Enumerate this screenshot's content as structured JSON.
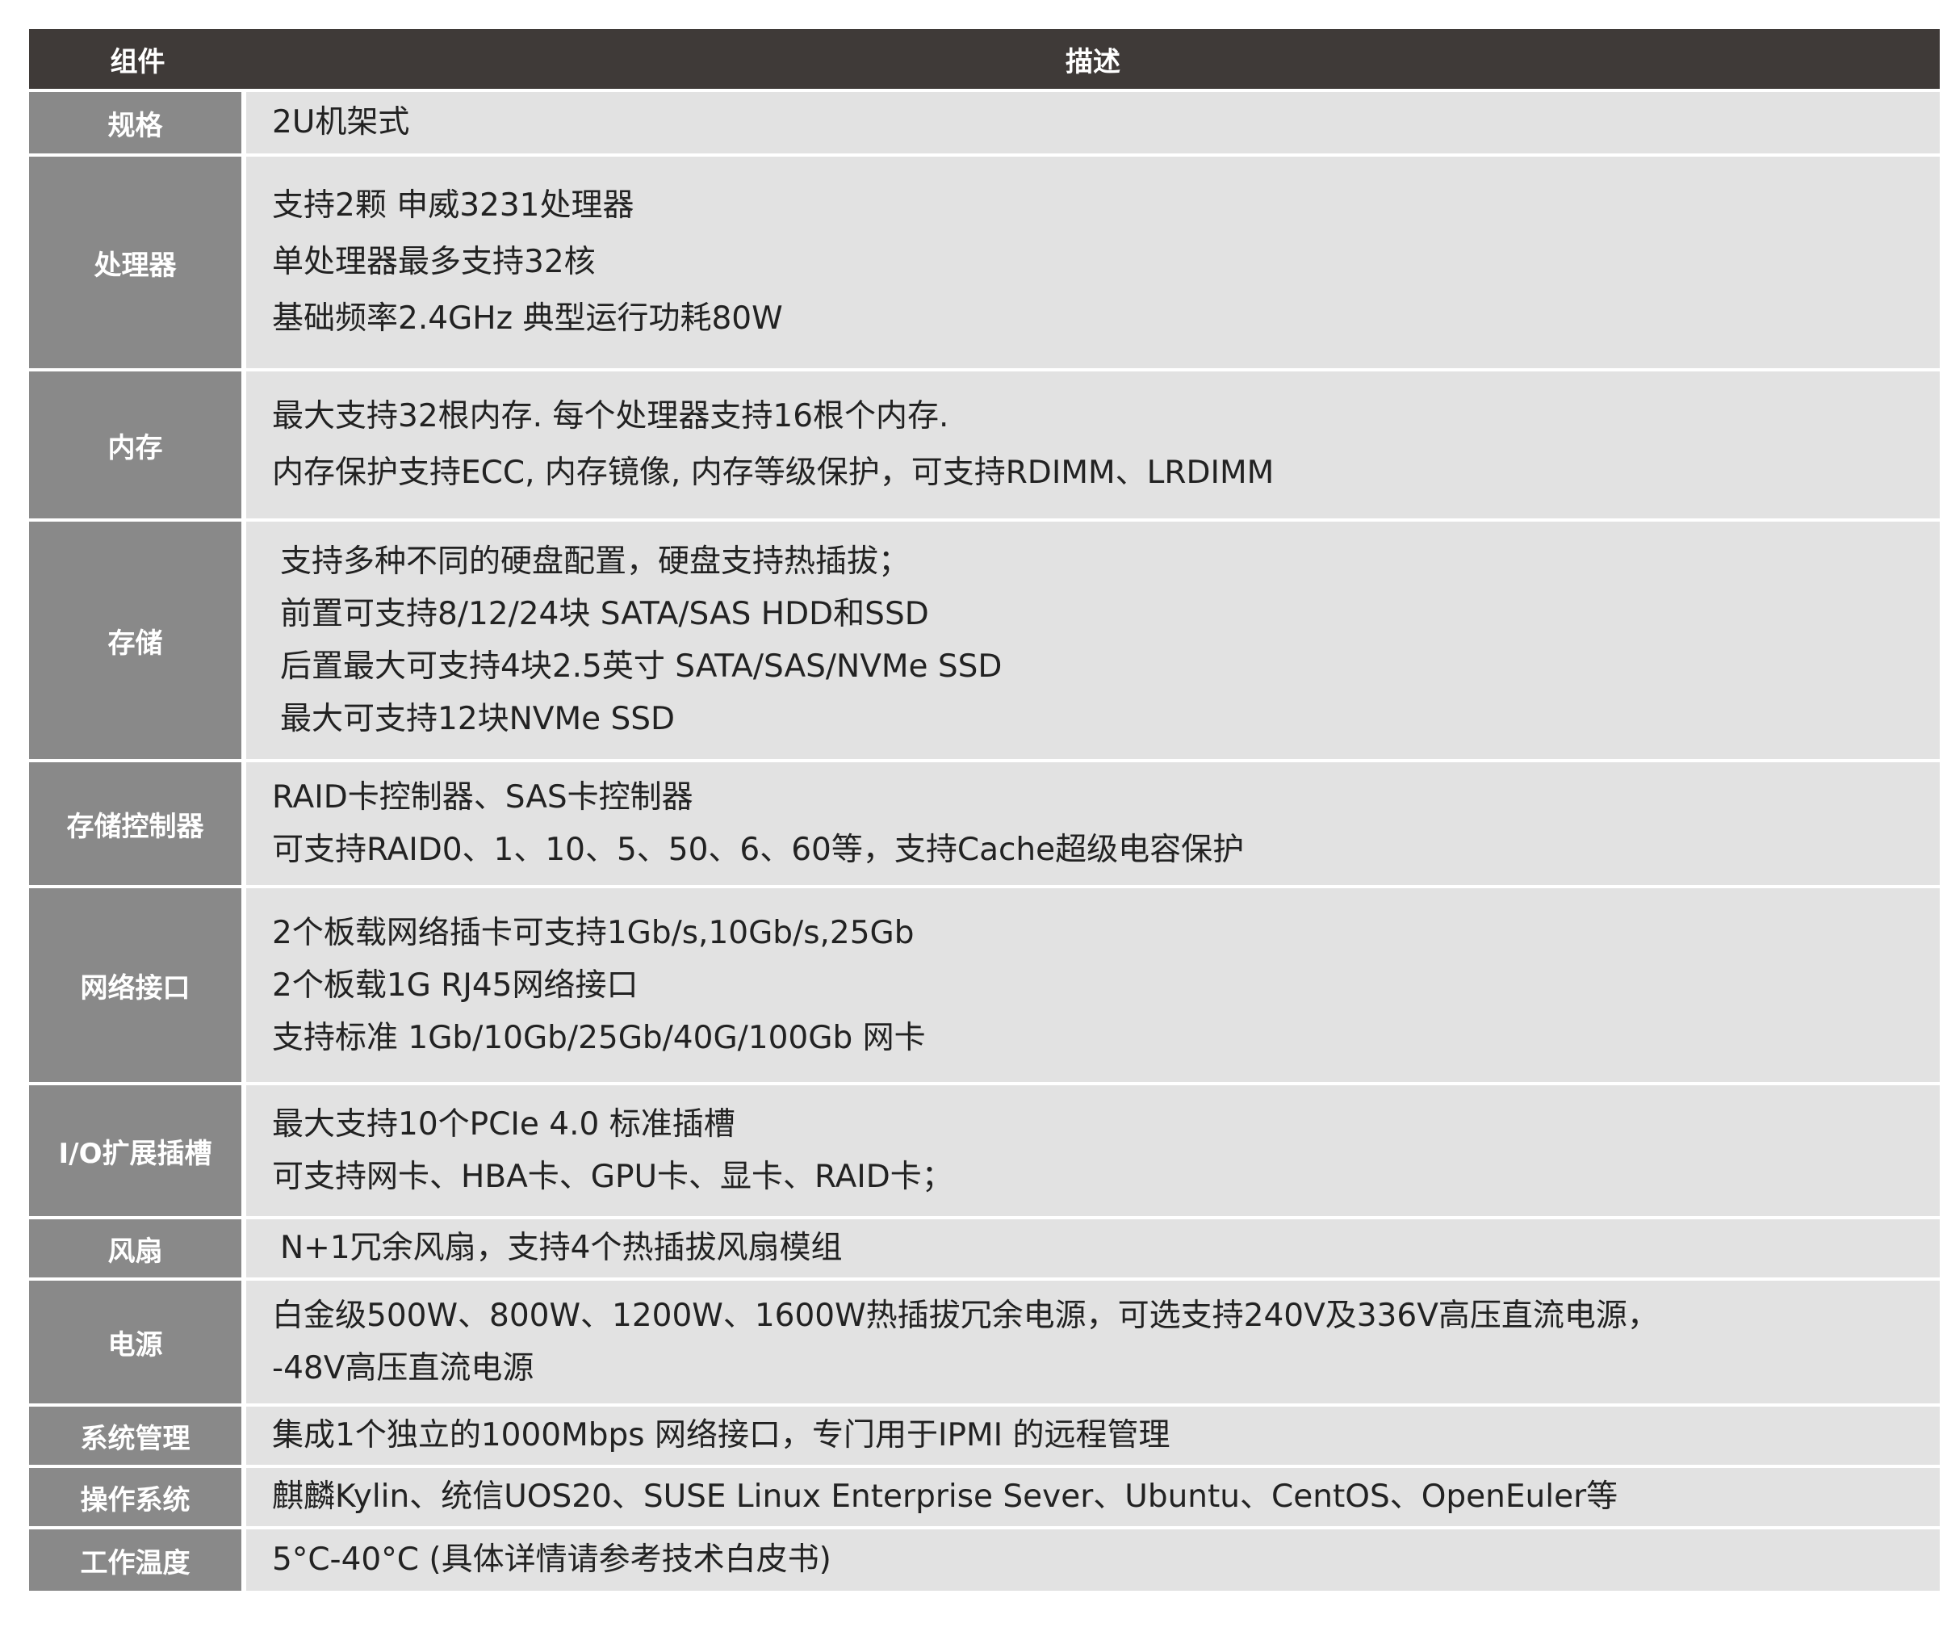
{
  "table": {
    "header": {
      "component": "组件",
      "description": "描述"
    },
    "rows": [
      {
        "label": "规格",
        "lines": [
          "2U机架式"
        ]
      },
      {
        "label": "处理器",
        "lines": [
          "支持2颗 申威3231处理器",
          "单处理器最多支持32核",
          "基础频率2.4GHz 典型运行功耗80W"
        ]
      },
      {
        "label": "内存",
        "lines": [
          "最大支持32根内存. 每个处理器支持16根个内存.",
          "内存保护支持ECC, 内存镜像, 内存等级保护，可支持RDIMM、LRDIMM"
        ]
      },
      {
        "label": "存储",
        "lines": [
          "支持多种不同的硬盘配置，硬盘支持热插拔；",
          "前置可支持8/12/24块 SATA/SAS HDD和SSD",
          "后置最大可支持4块2.5英寸 SATA/SAS/NVMe SSD",
          "最大可支持12块NVMe SSD"
        ]
      },
      {
        "label": "存储控制器",
        "lines": [
          "RAID卡控制器、SAS卡控制器",
          "可支持RAID0、1、10、5、50、6、60等，支持Cache超级电容保护"
        ]
      },
      {
        "label": "网络接口",
        "lines": [
          "2个板载网络插卡可支持1Gb/s,10Gb/s,25Gb",
          "2个板载1G RJ45网络接口",
          "支持标准 1Gb/10Gb/25Gb/40G/100Gb 网卡"
        ]
      },
      {
        "label": "I/O扩展插槽",
        "lines": [
          "最大支持10个PCIe 4.0 标准插槽",
          "可支持网卡、HBA卡、GPU卡、显卡、RAID卡；"
        ]
      },
      {
        "label": "风扇",
        "lines": [
          "N+1冗余风扇，支持4个热插拔风扇模组"
        ]
      },
      {
        "label": "电源",
        "lines": [
          "白金级500W、800W、1200W、1600W热插拔冗余电源，可选支持240V及336V高压直流电源，",
          "-48V高压直流电源"
        ]
      },
      {
        "label": "系统管理",
        "lines": [
          "集成1个独立的1000Mbps 网络接口，专门用于IPMI 的远程管理"
        ]
      },
      {
        "label": "操作系统",
        "lines": [
          "麒麟Kylin、统信UOS20、SUSE Linux Enterprise Sever、Ubuntu、CentOS、OpenEuler等"
        ]
      },
      {
        "label": "工作温度",
        "lines": [
          "5°C-40°C (具体详情请参考技术白皮书)"
        ]
      }
    ]
  }
}
